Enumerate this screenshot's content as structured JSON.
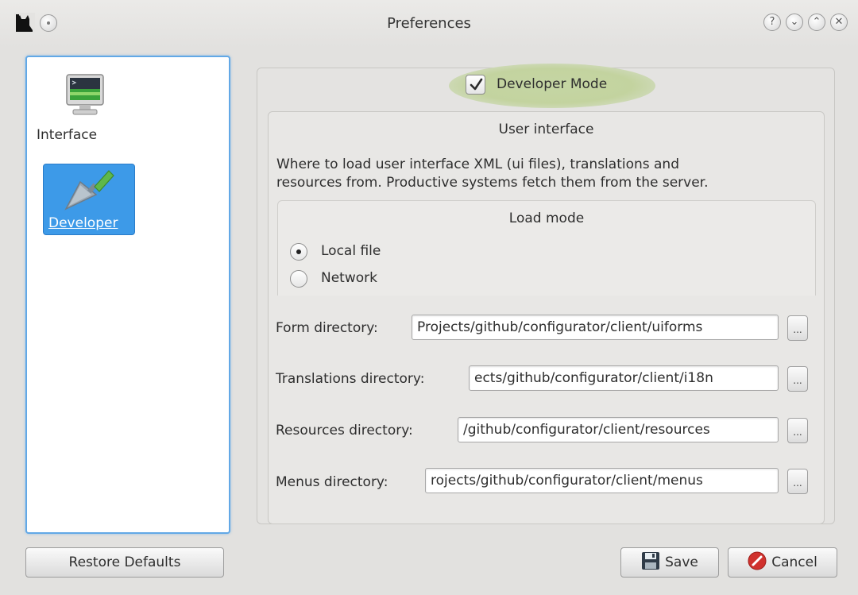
{
  "window": {
    "title": "Preferences",
    "buttons": {
      "help": "?",
      "minimize": "⌄",
      "maximize": "⌃",
      "close": "✕"
    }
  },
  "sidebar": {
    "items": [
      {
        "label": "Interface",
        "icon": "monitor-icon",
        "selected": false
      },
      {
        "label": "Developer",
        "icon": "trowel-icon",
        "selected": true
      }
    ]
  },
  "developer_mode": {
    "label": "Developer Mode",
    "checked": true
  },
  "user_interface": {
    "title": "User interface",
    "description_line1": "Where to load user interface XML (ui files), translations and",
    "description_line2": "resources from. Productive systems fetch them from the server.",
    "load_mode": {
      "title": "Load mode",
      "options": [
        {
          "label": "Local file",
          "selected": true
        },
        {
          "label": "Network",
          "selected": false
        }
      ]
    },
    "directories": [
      {
        "label": "Form directory:",
        "value": "Projects/github/configurator/client/uiforms",
        "button": "..."
      },
      {
        "label": "Translations directory:",
        "value": "ects/github/configurator/client/i18n",
        "button": "..."
      },
      {
        "label": "Resources directory:",
        "value": "/github/configurator/client/resources",
        "button": "..."
      },
      {
        "label": "Menus directory:",
        "value": "rojects/github/configurator/client/menus",
        "button": "..."
      }
    ]
  },
  "footer": {
    "restore_defaults": "Restore Defaults",
    "save": "Save",
    "cancel": "Cancel"
  },
  "colors": {
    "selection": "#3d9ae8",
    "highlight": "#c3d39f",
    "cancel_icon": "#d0312d"
  }
}
